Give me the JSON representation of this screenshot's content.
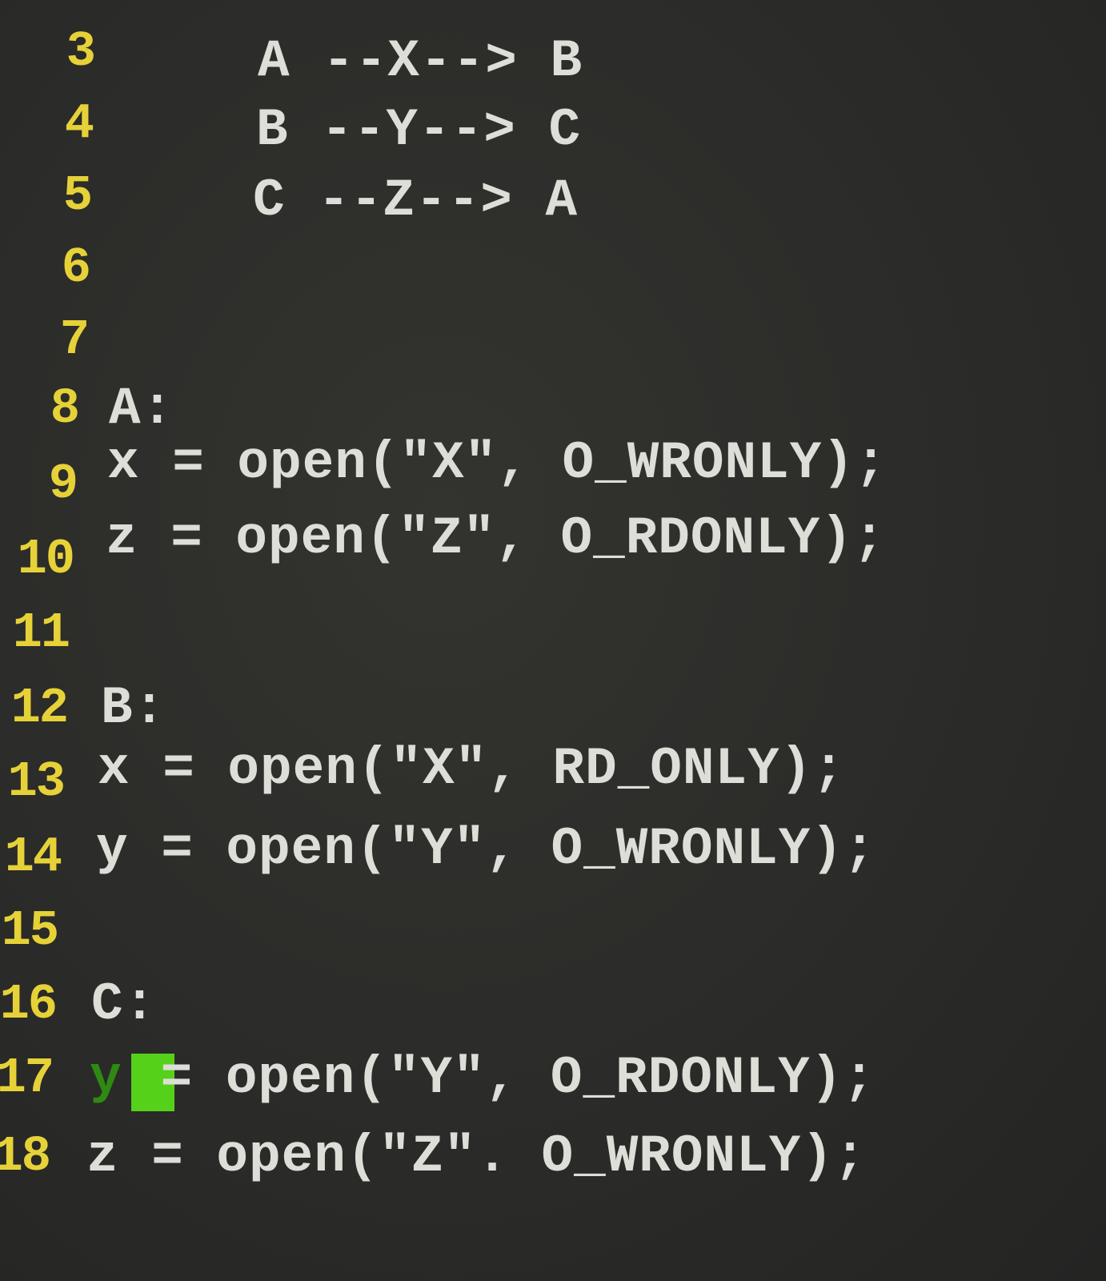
{
  "editor": {
    "lines": [
      {
        "number": "3",
        "text": "A --X--> B"
      },
      {
        "number": "4",
        "text": "B --Y--> C"
      },
      {
        "number": "5",
        "text": "C --Z--> A"
      },
      {
        "number": "6",
        "text": ""
      },
      {
        "number": "7",
        "text": ""
      },
      {
        "number": "8",
        "text": "A:"
      },
      {
        "number": "9",
        "text": "x = open(\"X\", O_WRONLY);"
      },
      {
        "number": "10",
        "text": "z = open(\"Z\", O_RDONLY);"
      },
      {
        "number": "11",
        "text": ""
      },
      {
        "number": "12",
        "text": "B:"
      },
      {
        "number": "13",
        "text": "x = open(\"X\", RD_ONLY);"
      },
      {
        "number": "14",
        "text": "y = open(\"Y\", O_WRONLY);"
      },
      {
        "number": "15",
        "text": ""
      },
      {
        "number": "16",
        "text": "C:"
      },
      {
        "number": "17",
        "cursor_char": "y",
        "text": " = open(\"Y\", O_RDONLY);"
      },
      {
        "number": "18",
        "text": "z = open(\"Z\". O_WRONLY);"
      }
    ]
  },
  "colors": {
    "background": "#2b2b29",
    "line_number": "#e6d238",
    "code_text": "#ddded8",
    "cursor": "#56d11a"
  }
}
